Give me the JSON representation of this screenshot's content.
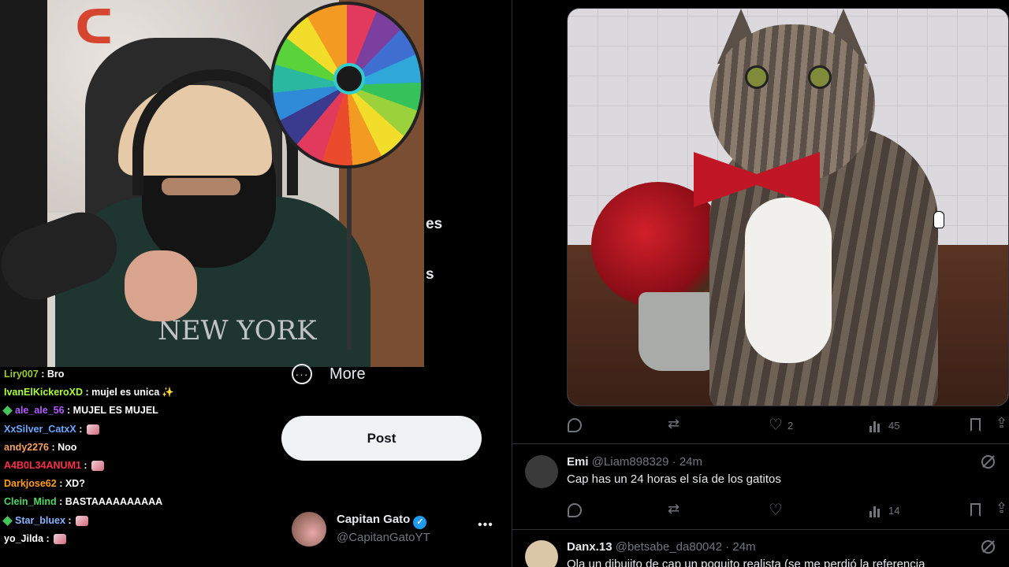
{
  "webcam": {
    "shirt_print": "NEW YORK"
  },
  "chat": {
    "messages": [
      {
        "user": "Liry007",
        "color": "#9acd32",
        "badge": false,
        "text": "Bro",
        "emote": false,
        "sparkle": false
      },
      {
        "user": "IvanElKickeroXD",
        "color": "#adff2f",
        "badge": false,
        "text": "mujel es unica",
        "emote": false,
        "sparkle": true
      },
      {
        "user": "ale_ale_56",
        "color": "#b05cff",
        "badge": true,
        "text": "MUJEL ES MUJEL",
        "emote": false,
        "sparkle": false
      },
      {
        "user": "XxSilver_CatxX",
        "color": "#6aa8ff",
        "badge": false,
        "text": "",
        "emote": true,
        "sparkle": false
      },
      {
        "user": "andy2276",
        "color": "#f4a261",
        "badge": false,
        "text": "Noo",
        "emote": false,
        "sparkle": false
      },
      {
        "user": "A4B0L34ANUM1",
        "color": "#ff2f4a",
        "badge": false,
        "text": "",
        "emote": true,
        "sparkle": false
      },
      {
        "user": "Darkjose62",
        "color": "#ff9f1c",
        "badge": false,
        "text": "XD?",
        "emote": false,
        "sparkle": false
      },
      {
        "user": "Clein_Mind",
        "color": "#4cd964",
        "badge": false,
        "text": "BASTAAAAAAAAAA",
        "emote": false,
        "sparkle": false
      },
      {
        "user": "Star_bluex",
        "color": "#8ab4ff",
        "badge": true,
        "text": "",
        "emote": true,
        "sparkle": false
      },
      {
        "user": "yo_Jilda",
        "color": "#ffffff",
        "badge": false,
        "text": "",
        "emote": true,
        "sparkle": false
      }
    ]
  },
  "sidenav": {
    "frag1": "es",
    "frag2": "s",
    "more_label": "More",
    "more_icon": "ellipsis-circle-icon",
    "post_label": "Post"
  },
  "account": {
    "name": "Capitan Gato",
    "handle": "@CapitanGatoYT",
    "verified_icon": "✓",
    "menu_icon": "•••"
  },
  "main_tweet": {
    "media_alt_icon": "cat-photo",
    "likes": "2",
    "views": "45"
  },
  "replies": [
    {
      "name": "Emi",
      "handle": "@Liam898329",
      "time": "· 24m",
      "text": "Cap has un 24 horas el sía de los gatitos",
      "views": "14",
      "avatar_color": "#3a3a3a"
    },
    {
      "name": "Danx.13",
      "handle": "@betsabe_da80042",
      "time": "· 24m",
      "text": "Ola un dibujito de cap un poquito realista (se me perdió la referencia",
      "avatar_color": "#d9c7a8"
    }
  ],
  "colors": {
    "accent": "#1d9bf0",
    "muted": "#71767b",
    "text": "#e7e9ea",
    "border": "#2f3336"
  }
}
